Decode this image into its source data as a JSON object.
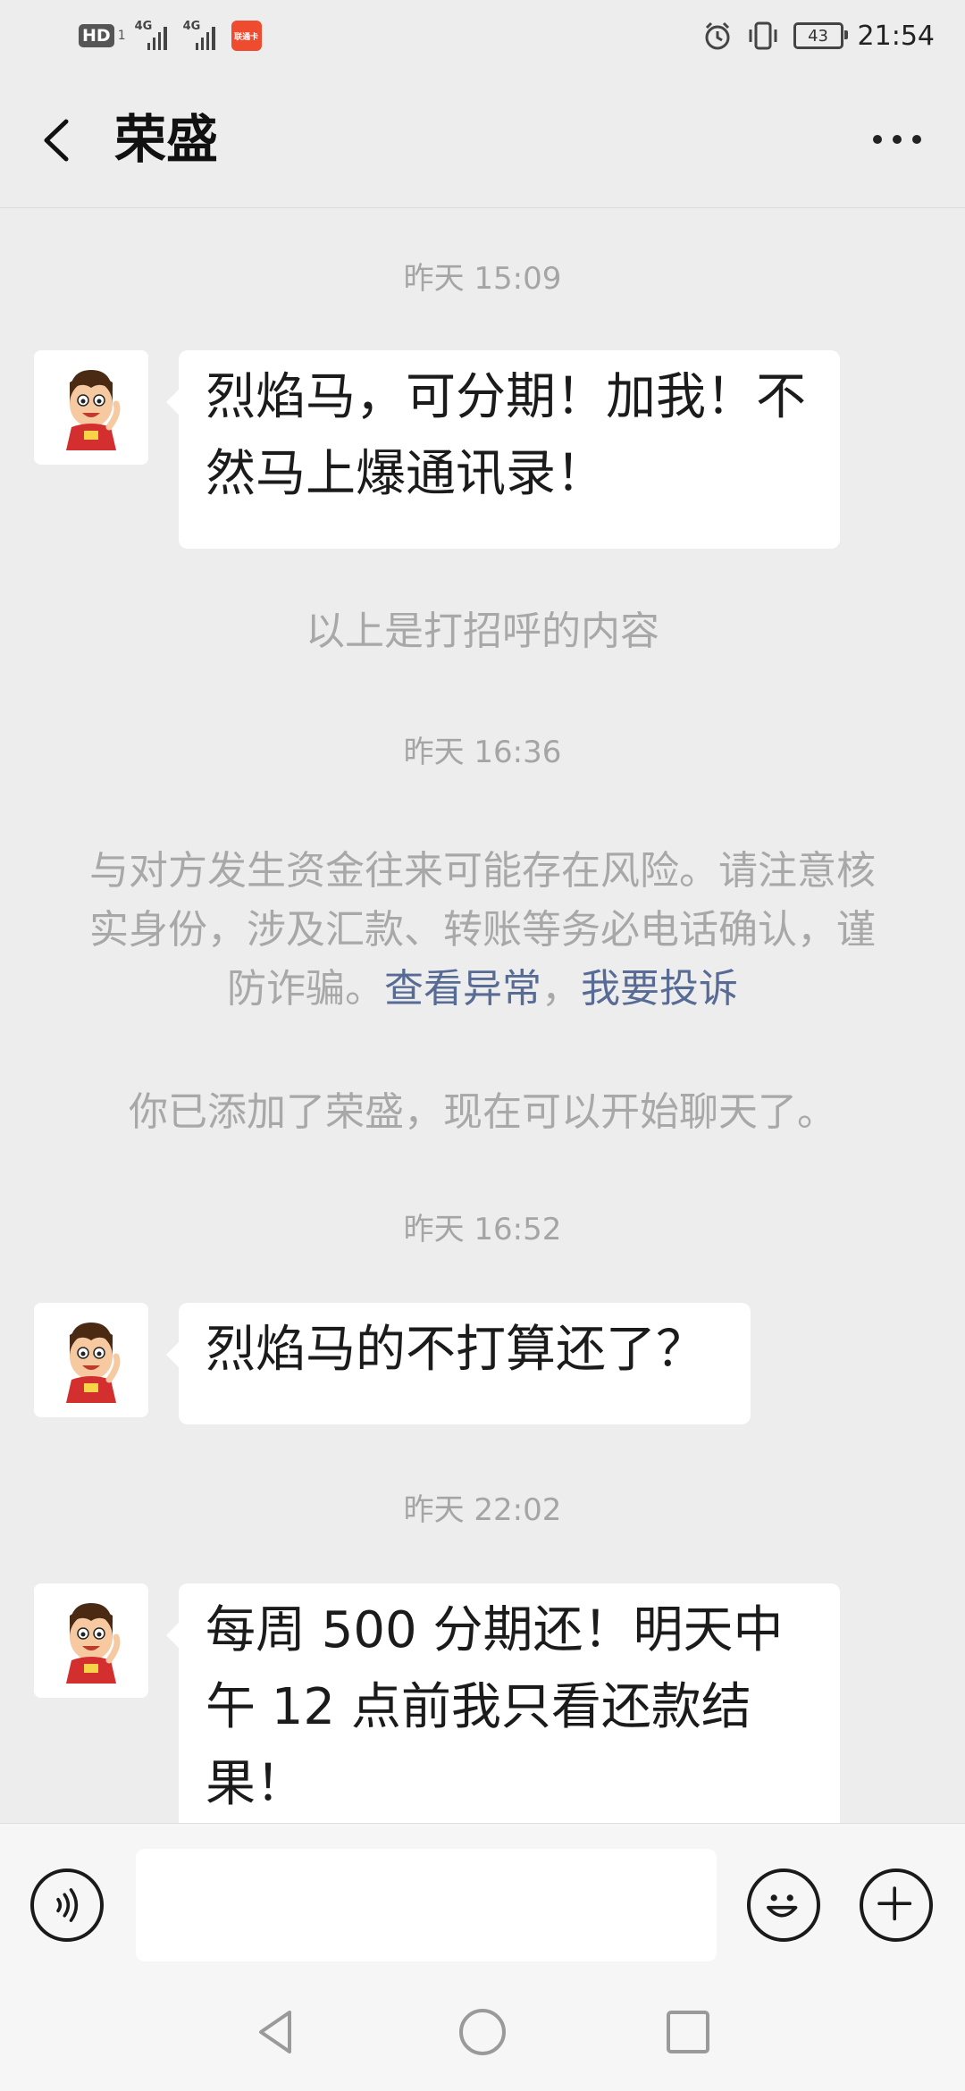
{
  "status_bar": {
    "hd": "HD",
    "hd_sub": "1",
    "net1": "4G",
    "net2": "4G",
    "carrier_badge": "联通卡",
    "battery": "43",
    "time": "21:54"
  },
  "header": {
    "title": "荣盛"
  },
  "messages": {
    "ts1": "昨天 15:09",
    "msg1": "烈焰马，可分期！加我！不然马上爆通讯录！",
    "greeting_note": "以上是打招呼的内容",
    "ts2": "昨天 16:36",
    "warning_text": "与对方发生资金往来可能存在风险。请注意核实身份，涉及汇款、转账等务必电话确认，谨防诈骗。",
    "warning_link1": "查看异常",
    "warning_sep": "，",
    "warning_link2": "我要投诉",
    "added_note": "你已添加了荣盛，现在可以开始聊天了。",
    "ts3": "昨天 16:52",
    "msg2": "烈焰马的不打算还了？",
    "ts4": "昨天 22:02",
    "msg3": "每周 500 分期还！明天中午 12 点前我只看还款结果！"
  },
  "input": {
    "value": "",
    "placeholder": ""
  },
  "icons": {
    "back": "back-arrow-icon",
    "more": "more-dots-icon",
    "voice": "voice-icon",
    "emoji": "emoji-icon",
    "plus": "plus-icon"
  },
  "colors": {
    "background": "#ededed",
    "link": "#576b95",
    "bubble": "#ffffff"
  }
}
